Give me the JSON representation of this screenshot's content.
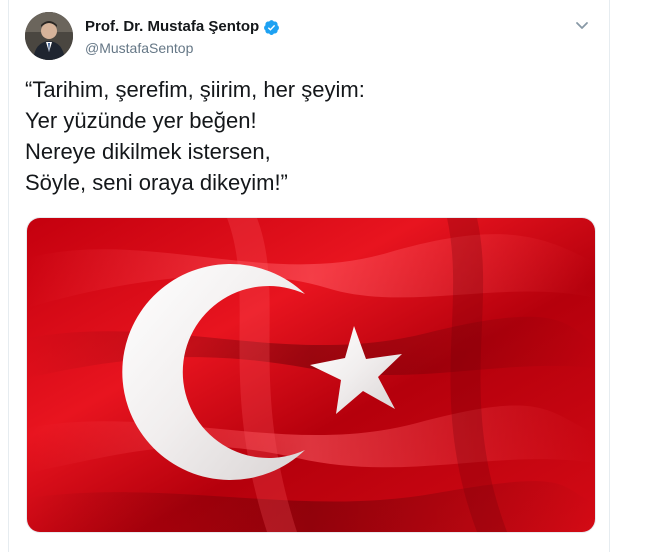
{
  "tweet": {
    "author": {
      "display_name": "Prof. Dr. Mustafa Şentop",
      "handle": "@MustafaSentop",
      "verified": true
    },
    "text": "“Tarihim, şerefim, şiirim, her şeyim:\nYer yüzünde yer beğen!\nNereye dikilmek istersen,\nSöyle, seni oraya dikeyim!”",
    "media": {
      "kind": "photo",
      "subject": "waving Turkish flag"
    }
  },
  "icons": {
    "verified": "verified-badge-icon",
    "menu": "chevron-down-icon"
  },
  "colors": {
    "accent": "#1da1f2",
    "flag_red": "#e30a17",
    "text_primary": "#14171a",
    "text_secondary": "#657786"
  }
}
